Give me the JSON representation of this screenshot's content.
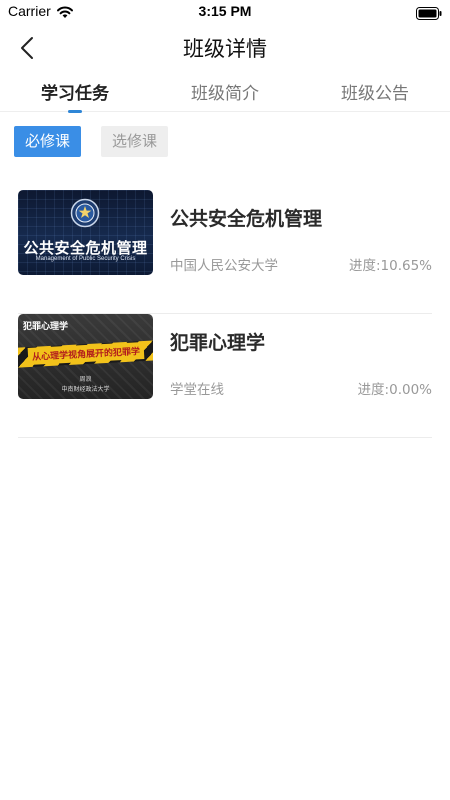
{
  "status_bar": {
    "carrier": "Carrier",
    "time": "3:15 PM",
    "wifi_icon": "wifi-icon",
    "battery_icon": "battery-icon"
  },
  "nav": {
    "back_icon": "chevron-left-icon",
    "title": "班级详情"
  },
  "tabs": [
    {
      "label": "学习任务",
      "active": true
    },
    {
      "label": "班级简介",
      "active": false
    },
    {
      "label": "班级公告",
      "active": false
    }
  ],
  "filters": [
    {
      "label": "必修课",
      "selected": true
    },
    {
      "label": "选修课",
      "selected": false
    }
  ],
  "courses": [
    {
      "title": "公共安全危机管理",
      "school": "中国人民公安大学",
      "progress": "进度:10.65%",
      "thumbnail": {
        "main_text": "公共安全危机管理",
        "sub_text": "Management of Public Security Crisis"
      }
    },
    {
      "title": "犯罪心理学",
      "school": "学堂在线",
      "progress": "进度:0.00%",
      "thumbnail": {
        "top_text": "犯罪心理学",
        "tape_text": "从心理学视角展开的犯罪学",
        "author": "周浪",
        "university": "中南财经政法大学"
      }
    }
  ],
  "colors": {
    "accent": "#3a8ee6",
    "tab_indicator": "#2f86d6",
    "muted_text": "#999999"
  }
}
